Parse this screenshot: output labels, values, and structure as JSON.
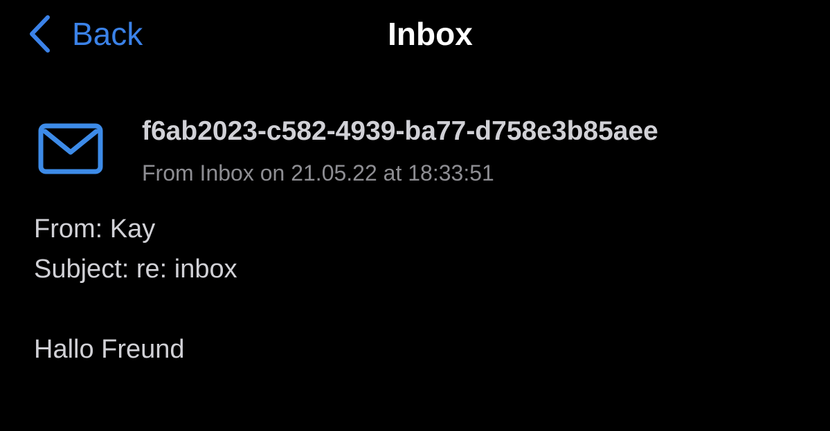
{
  "nav": {
    "back_label": "Back",
    "title": "Inbox"
  },
  "message": {
    "icon": "mail-envelope-icon",
    "id": "f6ab2023-c582-4939-ba77-d758e3b85aee",
    "meta": "From Inbox on 21.05.22 at 18:33:51",
    "from_line": "From: Kay",
    "subject_line": "Subject: re: inbox",
    "body": "Hallo Freund"
  },
  "colors": {
    "background": "#000000",
    "accent": "#3b82e8",
    "title": "#ffffff",
    "text": "#d1d1d6",
    "secondary_text": "#8e8e93",
    "icon": "#3d8be8"
  }
}
